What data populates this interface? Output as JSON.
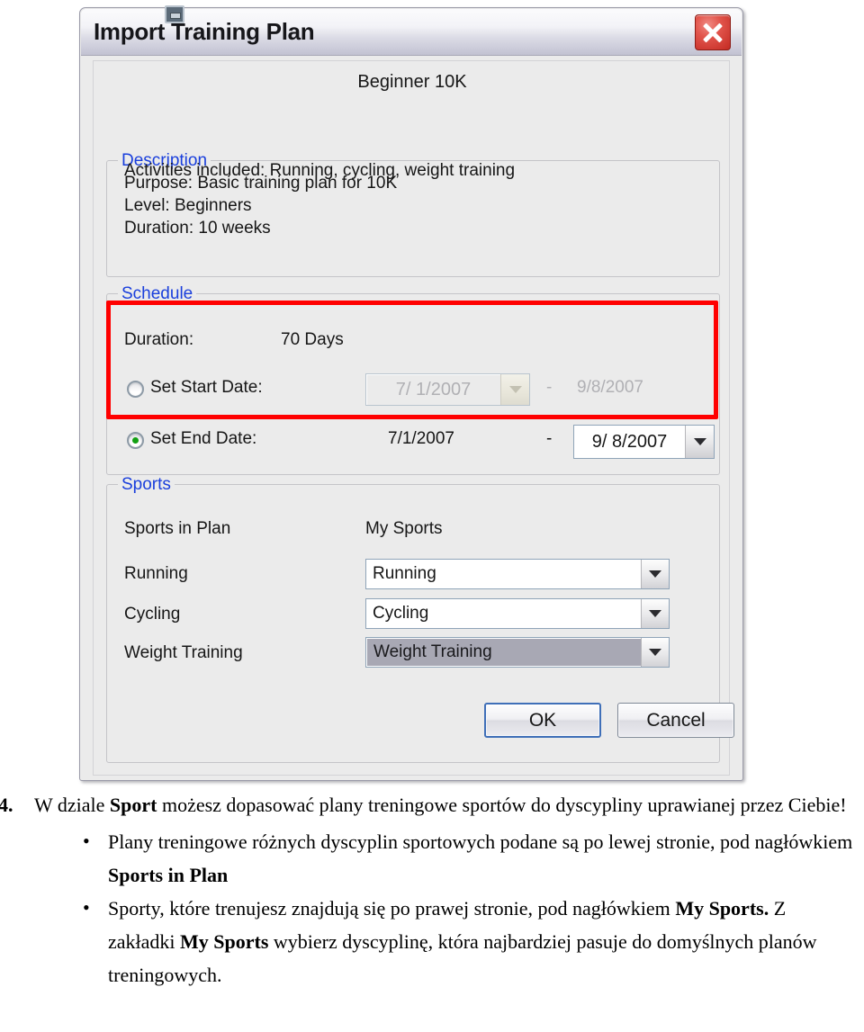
{
  "window": {
    "title": "Import Training Plan",
    "restore_icon": "restore-icon",
    "close_icon": "close-icon"
  },
  "plan": {
    "name": "Beginner 10K"
  },
  "description": {
    "legend": "Description",
    "lines": [
      "Purpose: Basic training plan for 10K",
      "Level: Beginners",
      "Duration: 10 weeks",
      "Activities included: Running, cycling, weight training"
    ]
  },
  "schedule": {
    "legend": "Schedule",
    "duration_label": "Duration:",
    "duration_value": "70  Days",
    "start": {
      "radio_label": "Set Start Date:",
      "selected": false,
      "picker_value": "7/ 1/2007",
      "separator": "-",
      "end_value": "9/8/2007",
      "disabled": true
    },
    "end": {
      "radio_label": "Set End Date:",
      "selected": true,
      "start_value": "7/1/2007",
      "separator": "-",
      "picker_value": "9/ 8/2007",
      "disabled": false
    }
  },
  "sports": {
    "legend": "Sports",
    "col_plan_header": "Sports in Plan",
    "col_mine_header": "My Sports",
    "rows": [
      {
        "plan": "Running",
        "mine": "Running",
        "highlighted": false
      },
      {
        "plan": "Cycling",
        "mine": "Cycling",
        "highlighted": false
      },
      {
        "plan": "Weight Training",
        "mine": "Weight Training",
        "highlighted": true
      }
    ]
  },
  "buttons": {
    "ok": "OK",
    "cancel": "Cancel"
  },
  "annotation": {
    "highlight_color": "#ff0000"
  },
  "document": {
    "numbered_item": {
      "marker": "4.",
      "parts": [
        {
          "text": "W dziale ",
          "bold": false
        },
        {
          "text": "Sport",
          "bold": true
        },
        {
          "text": " możesz dopasować plany treningowe sportów do dyscypliny uprawianej przez Ciebie!",
          "bold": false
        }
      ]
    },
    "bullets": [
      {
        "marker": "•",
        "parts": [
          {
            "text": "Plany treningowe różnych dyscyplin sportowych podane są po lewej stronie, pod nagłówkiem ",
            "bold": false
          },
          {
            "text": "Sports in Plan",
            "bold": true
          }
        ]
      },
      {
        "marker": "•",
        "parts": [
          {
            "text": "Sporty, które trenujesz znajdują się po prawej stronie, pod nagłówkiem ",
            "bold": false
          },
          {
            "text": "My Sports.",
            "bold": true
          },
          {
            "text": " Z zakładki ",
            "bold": false
          },
          {
            "text": "My Sports",
            "bold": true
          },
          {
            "text": " wybierz dyscyplinę, która najbardziej pasuje do domyślnych planów treningowych.",
            "bold": false
          }
        ]
      }
    ]
  }
}
